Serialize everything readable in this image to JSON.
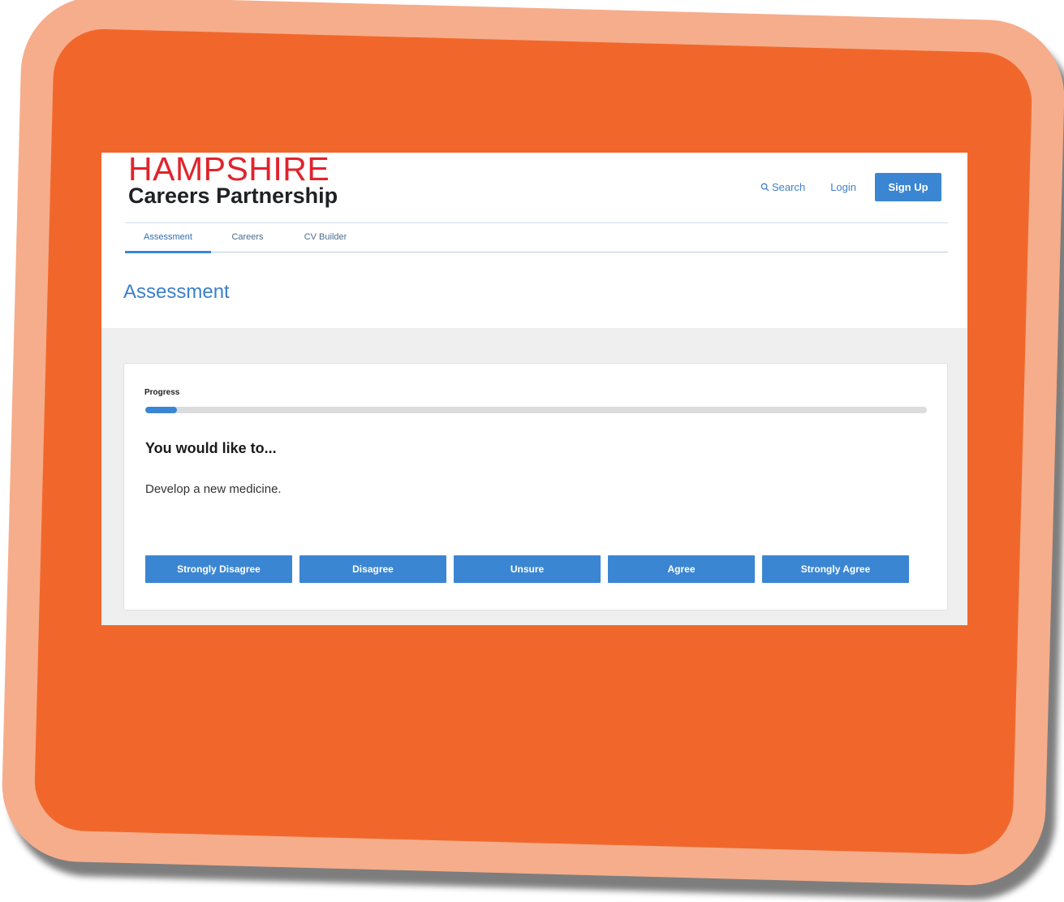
{
  "brand": {
    "logo_line1": "HAMPSHIRE",
    "logo_line2": "Careers Partnership",
    "logo_color": "#e0242c"
  },
  "header": {
    "search_label": "Search",
    "search_icon": "search-icon",
    "login_label": "Login",
    "signup_label": "Sign Up"
  },
  "nav": {
    "tabs": [
      {
        "label": "Assessment",
        "active": true
      },
      {
        "label": "Careers",
        "active": false
      },
      {
        "label": "CV Builder",
        "active": false
      }
    ]
  },
  "page": {
    "title": "Assessment"
  },
  "assessment": {
    "progress_label": "Progress",
    "progress_fraction": 0.04,
    "question_heading": "You would like to...",
    "question_text": "Develop a new medicine.",
    "answers": [
      "Strongly Disagree",
      "Disagree",
      "Unsure",
      "Agree",
      "Strongly Agree"
    ]
  },
  "colors": {
    "accent": "#3b86d2",
    "frame_outer": "#f6ad8b",
    "frame_inner": "#f1672b",
    "content_bg": "#efefef"
  }
}
